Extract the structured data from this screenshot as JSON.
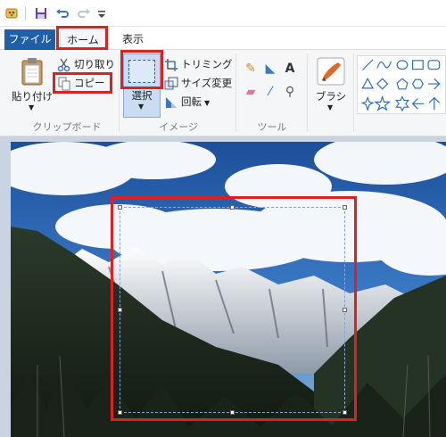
{
  "quick_access": {
    "icons": [
      "paint-app-icon",
      "save-icon",
      "undo-icon",
      "redo-icon",
      "customize-qat-icon"
    ]
  },
  "tabs": {
    "file": "ファイル",
    "home": "ホーム",
    "view": "表示"
  },
  "clipboard": {
    "paste": "貼り付け",
    "cut": "切り取り",
    "copy": "コピー",
    "group_label": "クリップボード"
  },
  "image": {
    "select": "選択",
    "crop": "トリミング",
    "resize": "サイズ変更",
    "rotate": "回転",
    "group_label": "イメージ"
  },
  "tools": {
    "group_label": "ツール",
    "items": [
      "pencil-icon",
      "fill-icon",
      "text-icon",
      "eraser-icon",
      "color-picker-icon",
      "magnifier-icon"
    ]
  },
  "brushes": {
    "label": "ブラシ"
  },
  "shapes": {
    "items": [
      "line",
      "curve",
      "oval",
      "rectangle",
      "rounded-rectangle",
      "triangle",
      "diamond",
      "pentagon",
      "hexagon",
      "star4",
      "star5",
      "star6",
      "arrow-right",
      "arrow-left",
      "arrow-up",
      "arrow-down"
    ]
  },
  "colors": {
    "accent": "#1e5fa8",
    "highlight": "#e02020",
    "ribbon_bg": "#f5f6f7",
    "canvas_bg": "#c9d3e2"
  }
}
